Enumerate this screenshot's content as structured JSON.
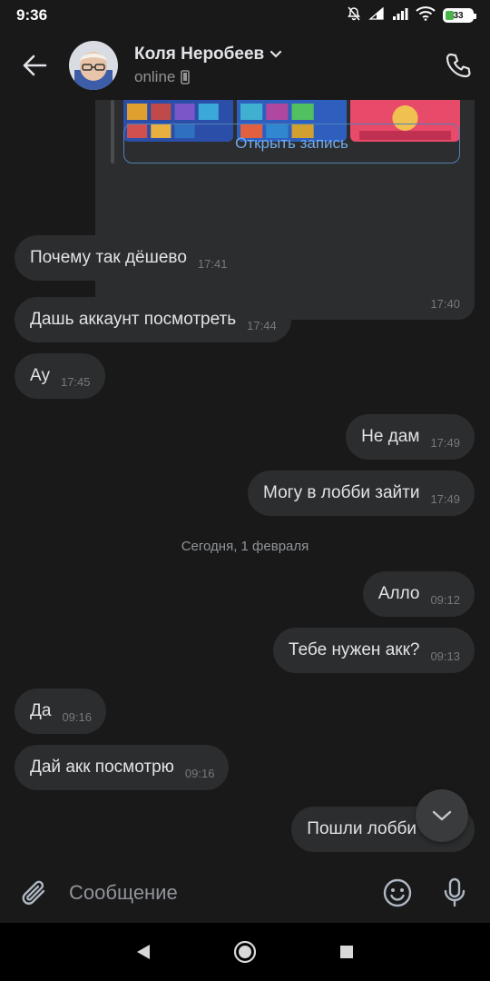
{
  "status_bar": {
    "time": "9:36",
    "battery": "33",
    "battery_level": 0.33
  },
  "header": {
    "contact_name": "Коля Неробеев",
    "status": "online"
  },
  "post": {
    "open_label": "Открыть запись",
    "time": "17:40"
  },
  "messages": [
    {
      "text": "Почему так дёшево",
      "time": "17:41",
      "dir": "in"
    },
    {
      "text": "Дашь аккаунт посмотреть",
      "time": "17:44",
      "dir": "in"
    },
    {
      "text": "Ау",
      "time": "17:45",
      "dir": "in"
    },
    {
      "text": "Не дам",
      "time": "17:49",
      "dir": "out"
    },
    {
      "text": "Могу в лобби зайти",
      "time": "17:49",
      "dir": "out"
    },
    {
      "text": "Алло",
      "time": "09:12",
      "dir": "out"
    },
    {
      "text": "Тебе нужен акк?",
      "time": "09:13",
      "dir": "out"
    },
    {
      "text": "Да",
      "time": "09:16",
      "dir": "in"
    },
    {
      "text": "Дай акк посмотрю",
      "time": "09:16",
      "dir": "in"
    },
    {
      "text": "Пошли лобби",
      "time": "",
      "dir": "out"
    }
  ],
  "date_separator": "Сегодня, 1 февраля",
  "composer": {
    "placeholder": "Сообщение"
  },
  "colors": {
    "background": "#19191a",
    "bubble": "#2c2d2e",
    "accent": "#71aaeb",
    "text": "#e1e3e6",
    "muted": "#76787a"
  }
}
